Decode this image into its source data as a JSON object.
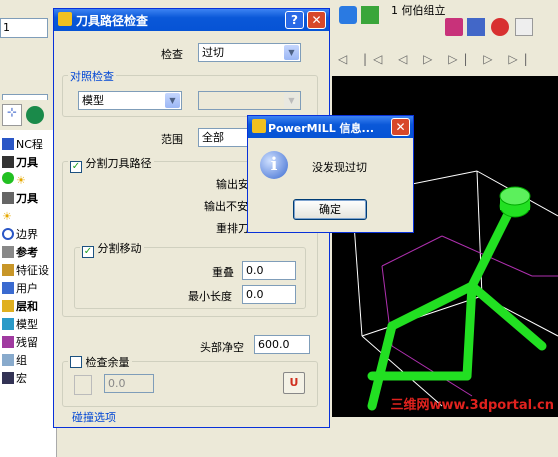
{
  "background": {
    "top_field": "1",
    "top_right_label": "1 何伯组立",
    "tree_items": [
      {
        "label": "NC程",
        "bold": false
      },
      {
        "label": "刀具",
        "bold": true
      },
      {
        "label": "刀具",
        "bold": true
      },
      {
        "label": "边界",
        "bold": false
      },
      {
        "label": "参考",
        "bold": true
      },
      {
        "label": "特征设",
        "bold": false
      },
      {
        "label": "用户",
        "bold": false
      },
      {
        "label": "层和",
        "bold": true
      },
      {
        "label": "模型",
        "bold": false
      },
      {
        "label": "残留",
        "bold": false
      },
      {
        "label": "组",
        "bold": false
      },
      {
        "label": "宏",
        "bold": false
      }
    ],
    "watermark": "三维网www.3dportal.cn"
  },
  "dialog": {
    "title": "刀具路径检查",
    "help_btn": "?",
    "close_btn": "✕",
    "check_label": "检查",
    "check_value": "过切",
    "compare_group": "对照检查",
    "compare_value": "模型",
    "compare_secondary": "",
    "range_label": "范围",
    "range_value": "全部",
    "split_toolpath_label": "分割刀具路径",
    "split_toolpath_checked": true,
    "output_safe": "输出安",
    "output_unsafe": "输出不安",
    "reorder": "重排刀",
    "split_moves_label": "分割移动",
    "split_moves_checked": true,
    "overlap_label": "重叠",
    "overlap_value": "0.0",
    "min_length_label": "最小长度",
    "min_length_value": "0.0",
    "head_clearance_label": "头部净空",
    "head_clearance_value": "600.0",
    "check_stock_label": "检查余量",
    "check_stock_checked": false,
    "stock_value": "0.0",
    "collision_options": "碰撞选项"
  },
  "info": {
    "title": "PowerMILL 信息...",
    "close_btn": "✕",
    "message": "没发现过切",
    "ok_label": "确定"
  },
  "colors": {
    "titlebar": "#0a58d8",
    "toolpath_green": "#22e022",
    "model_magenta": "#b030b0"
  }
}
